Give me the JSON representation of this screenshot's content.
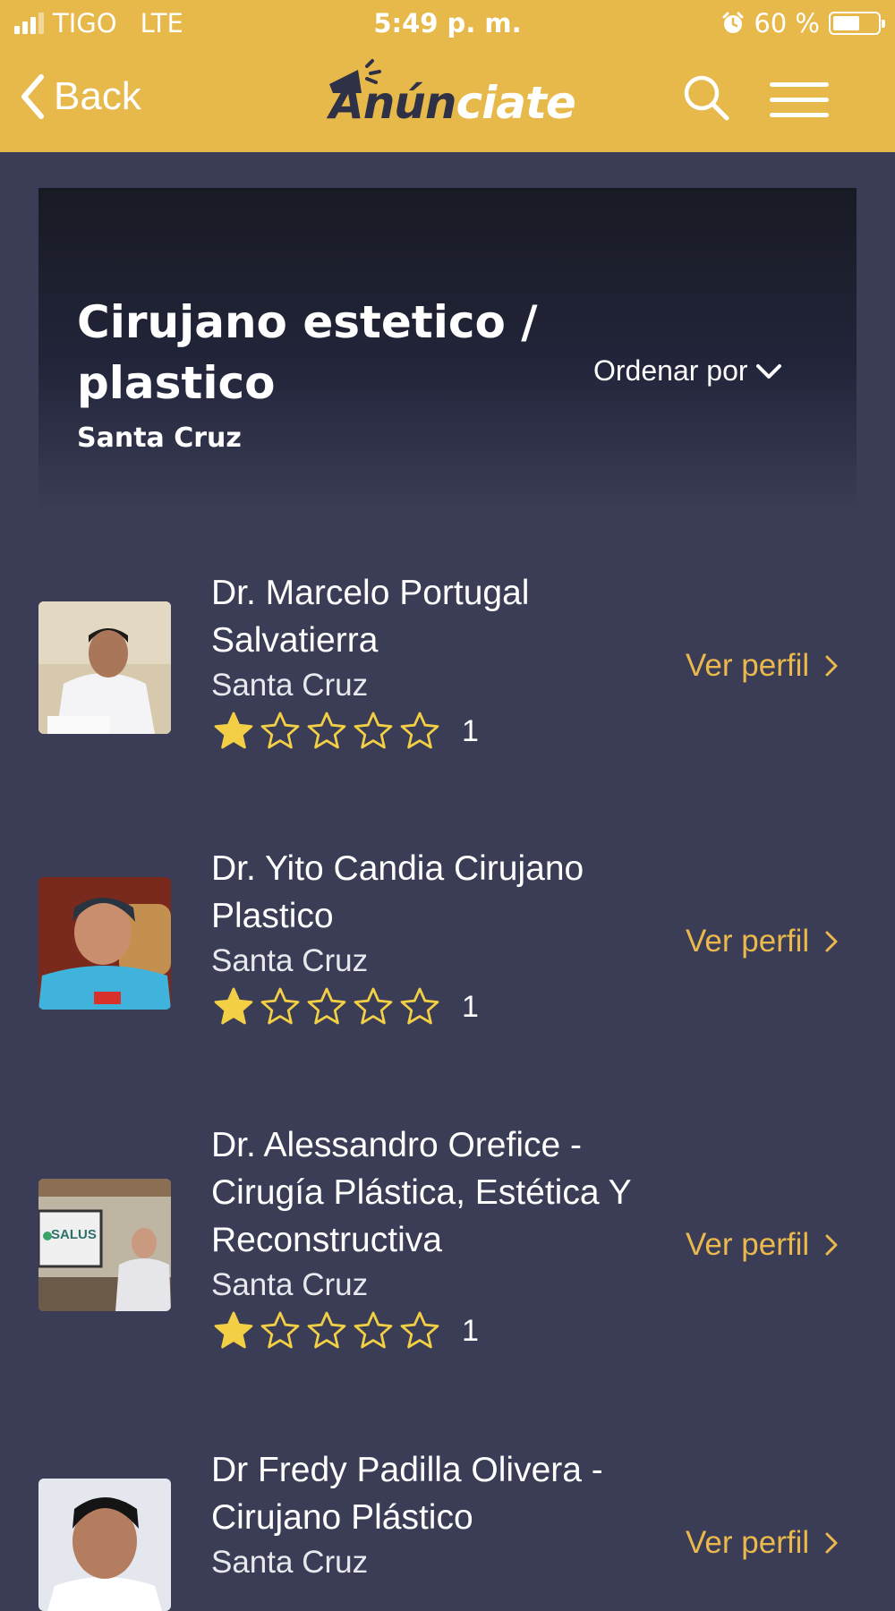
{
  "status_bar": {
    "carrier": "TIGO",
    "network": "LTE",
    "time": "5:49 p. m.",
    "battery": "60 %",
    "battery_level": 0.6
  },
  "nav": {
    "back_label": "Back",
    "logo_part1": "Anún",
    "logo_part2": "ciate"
  },
  "header": {
    "title": "Cirujano estetico / plastico",
    "location": "Santa Cruz",
    "sort_label": "Ordenar por"
  },
  "listings": [
    {
      "name": "Dr. Marcelo Portugal Salvatierra",
      "city": "Santa Cruz",
      "rating": 1,
      "max_rating": 5,
      "review_count": "1",
      "action": "Ver perfil"
    },
    {
      "name": "Dr. Yito Candia Cirujano Plastico",
      "city": "Santa Cruz",
      "rating": 1,
      "max_rating": 5,
      "review_count": "1",
      "action": "Ver perfil"
    },
    {
      "name": "Dr. Alessandro Orefice - Cirugía Plástica, Estética Y Reconstructiva",
      "city": "Santa Cruz",
      "rating": 1,
      "max_rating": 5,
      "review_count": "1",
      "action": "Ver perfil"
    },
    {
      "name": "Dr Fredy Padilla Olivera - Cirujano Plástico",
      "city": "Santa Cruz",
      "action": "Ver perfil"
    }
  ],
  "thumb_signage": "SALUS",
  "colors": {
    "accent": "#e7b84a",
    "background": "#3a3d55",
    "link": "#eab84c",
    "star": "#f2cf45"
  }
}
